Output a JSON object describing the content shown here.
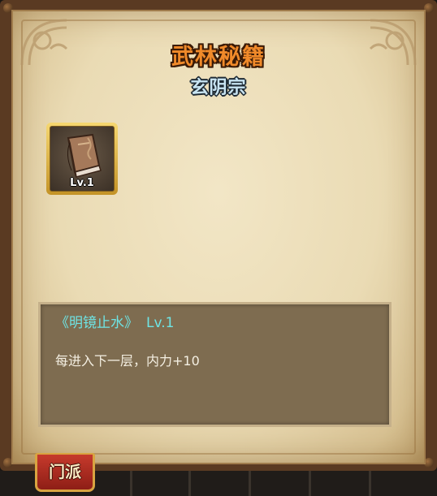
{
  "header": {
    "title": "武林秘籍",
    "sect": "玄阴宗"
  },
  "item_slot": {
    "icon": "book-icon",
    "level_label": "Lv.1"
  },
  "description": {
    "skill_name": "《明镜止水》",
    "skill_level": "Lv.1",
    "effect": "每进入下一层，内力+10"
  },
  "tabs": {
    "active_label": "门派"
  },
  "colors": {
    "title": "#f08a2a",
    "subtitle": "#c8e4f2",
    "skill_name": "#6ee4e4",
    "tab_active": "#b02a20"
  }
}
